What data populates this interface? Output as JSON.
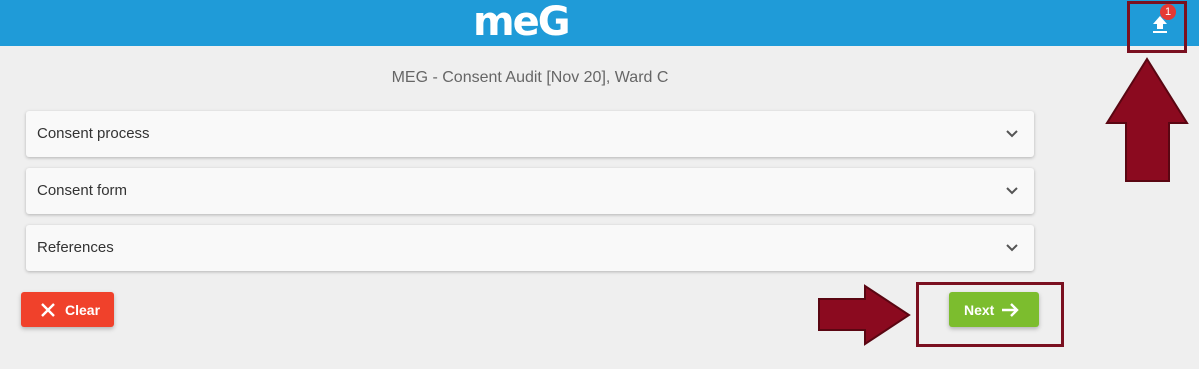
{
  "header": {
    "logo_text": "meG",
    "upload_badge": "1",
    "upload_icon": "upload-icon",
    "brand_color": "#1f9bd8"
  },
  "page": {
    "title": "MEG - Consent Audit [Nov 20], Ward C"
  },
  "accordion": {
    "items": [
      {
        "label": "Consent process"
      },
      {
        "label": "Consent form"
      },
      {
        "label": "References"
      }
    ],
    "toggle_icon": "chevron-down-icon"
  },
  "actions": {
    "clear_label": "Clear",
    "clear_icon": "close-icon",
    "clear_color": "#f0412b",
    "next_label": "Next",
    "next_icon": "arrow-right-icon",
    "next_color": "#7cbd2e"
  },
  "annotations": {
    "color": "#7a1020"
  }
}
